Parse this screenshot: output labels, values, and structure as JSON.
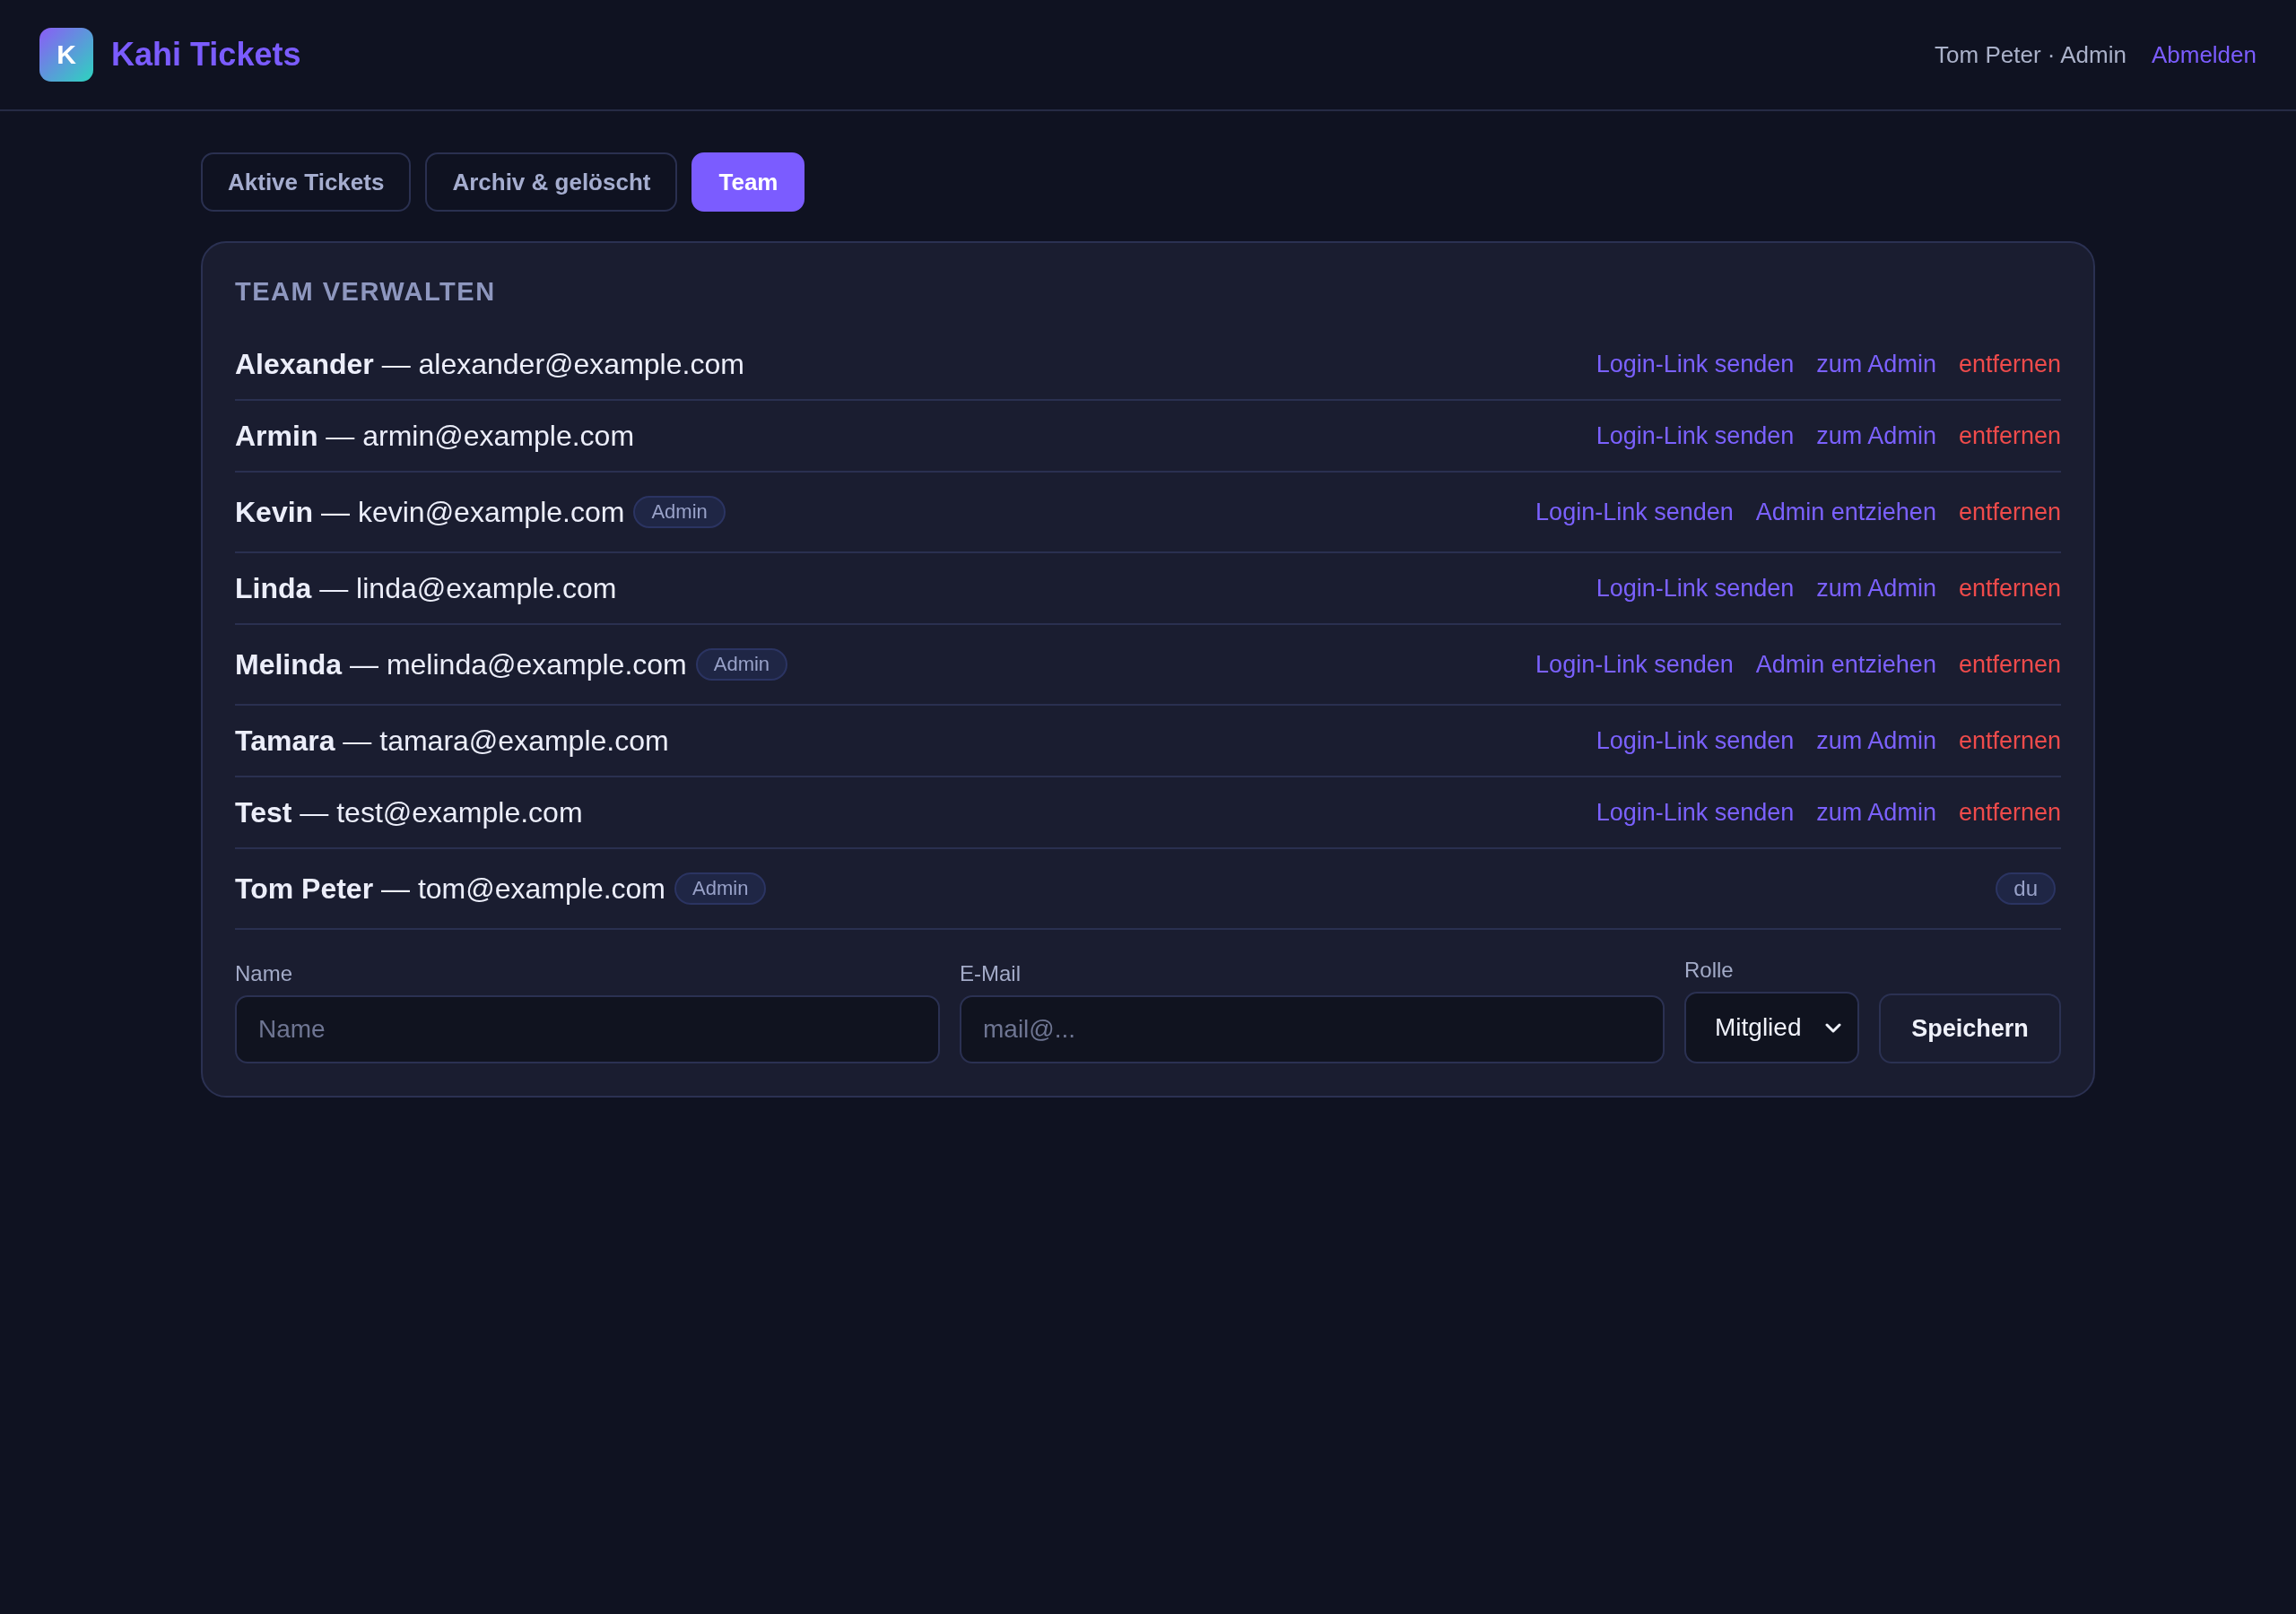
{
  "header": {
    "logo_letter": "K",
    "app_name": "Kahi Tickets",
    "user_label": "Tom Peter · Admin",
    "logout_link": "Abmelden"
  },
  "tabs": [
    {
      "label": "Aktive Tickets",
      "selected": false
    },
    {
      "label": "Archiv & gelöscht",
      "selected": false
    },
    {
      "label": "Team",
      "selected": true
    }
  ],
  "team_panel": {
    "title": "TEAM VERWALTEN",
    "members": [
      {
        "text": "**Alexander** — alexander@example.com",
        "actions": [
          {
            "label": "Login-Link senden",
            "kind": "link"
          },
          {
            "label": "zum Admin",
            "kind": "link"
          },
          {
            "label": "entfernen",
            "kind": "danger"
          }
        ]
      },
      {
        "text": "**Armin** — armin@example.com",
        "actions": [
          {
            "label": "Login-Link senden",
            "kind": "link"
          },
          {
            "label": "zum Admin",
            "kind": "link"
          },
          {
            "label": "entfernen",
            "kind": "danger"
          }
        ]
      },
      {
        "text": "**Kevin** — kevin@example.com",
        "badge": "Admin",
        "actions": [
          {
            "label": "Login-Link senden",
            "kind": "link"
          },
          {
            "label": "Admin entziehen",
            "kind": "link"
          },
          {
            "label": "entfernen",
            "kind": "danger"
          }
        ]
      },
      {
        "text": "**Linda** — linda@example.com",
        "actions": [
          {
            "label": "Login-Link senden",
            "kind": "link"
          },
          {
            "label": "zum Admin",
            "kind": "link"
          },
          {
            "label": "entfernen",
            "kind": "danger"
          }
        ]
      },
      {
        "text": "**Melinda** — melinda@example.com",
        "badge": "Admin",
        "actions": [
          {
            "label": "Login-Link senden",
            "kind": "link"
          },
          {
            "label": "Admin entziehen",
            "kind": "link"
          },
          {
            "label": "entfernen",
            "kind": "danger"
          }
        ]
      },
      {
        "text": "**Tamara** — tamara@example.com",
        "actions": [
          {
            "label": "Login-Link senden",
            "kind": "link"
          },
          {
            "label": "zum Admin",
            "kind": "link"
          },
          {
            "label": "entfernen",
            "kind": "danger"
          }
        ]
      },
      {
        "text": "**Test** — test@example.com",
        "actions": [
          {
            "label": "Login-Link senden",
            "kind": "link"
          },
          {
            "label": "zum Admin",
            "kind": "link"
          },
          {
            "label": "entfernen",
            "kind": "danger"
          }
        ]
      },
      {
        "text": "**Tom Peter** — tom@example.com",
        "badge": "Admin",
        "actions": [
          {
            "label": "du",
            "kind": "tag"
          }
        ]
      }
    ],
    "add_form": {
      "fields": [
        {
          "kind": "input",
          "label": "Name",
          "placeholder": "Name"
        },
        {
          "kind": "input",
          "label": "E-Mail",
          "placeholder": "mail@..."
        },
        {
          "kind": "select",
          "label": "Rolle",
          "value": "Mitglied"
        }
      ],
      "submit_button": "Speichern"
    }
  }
}
